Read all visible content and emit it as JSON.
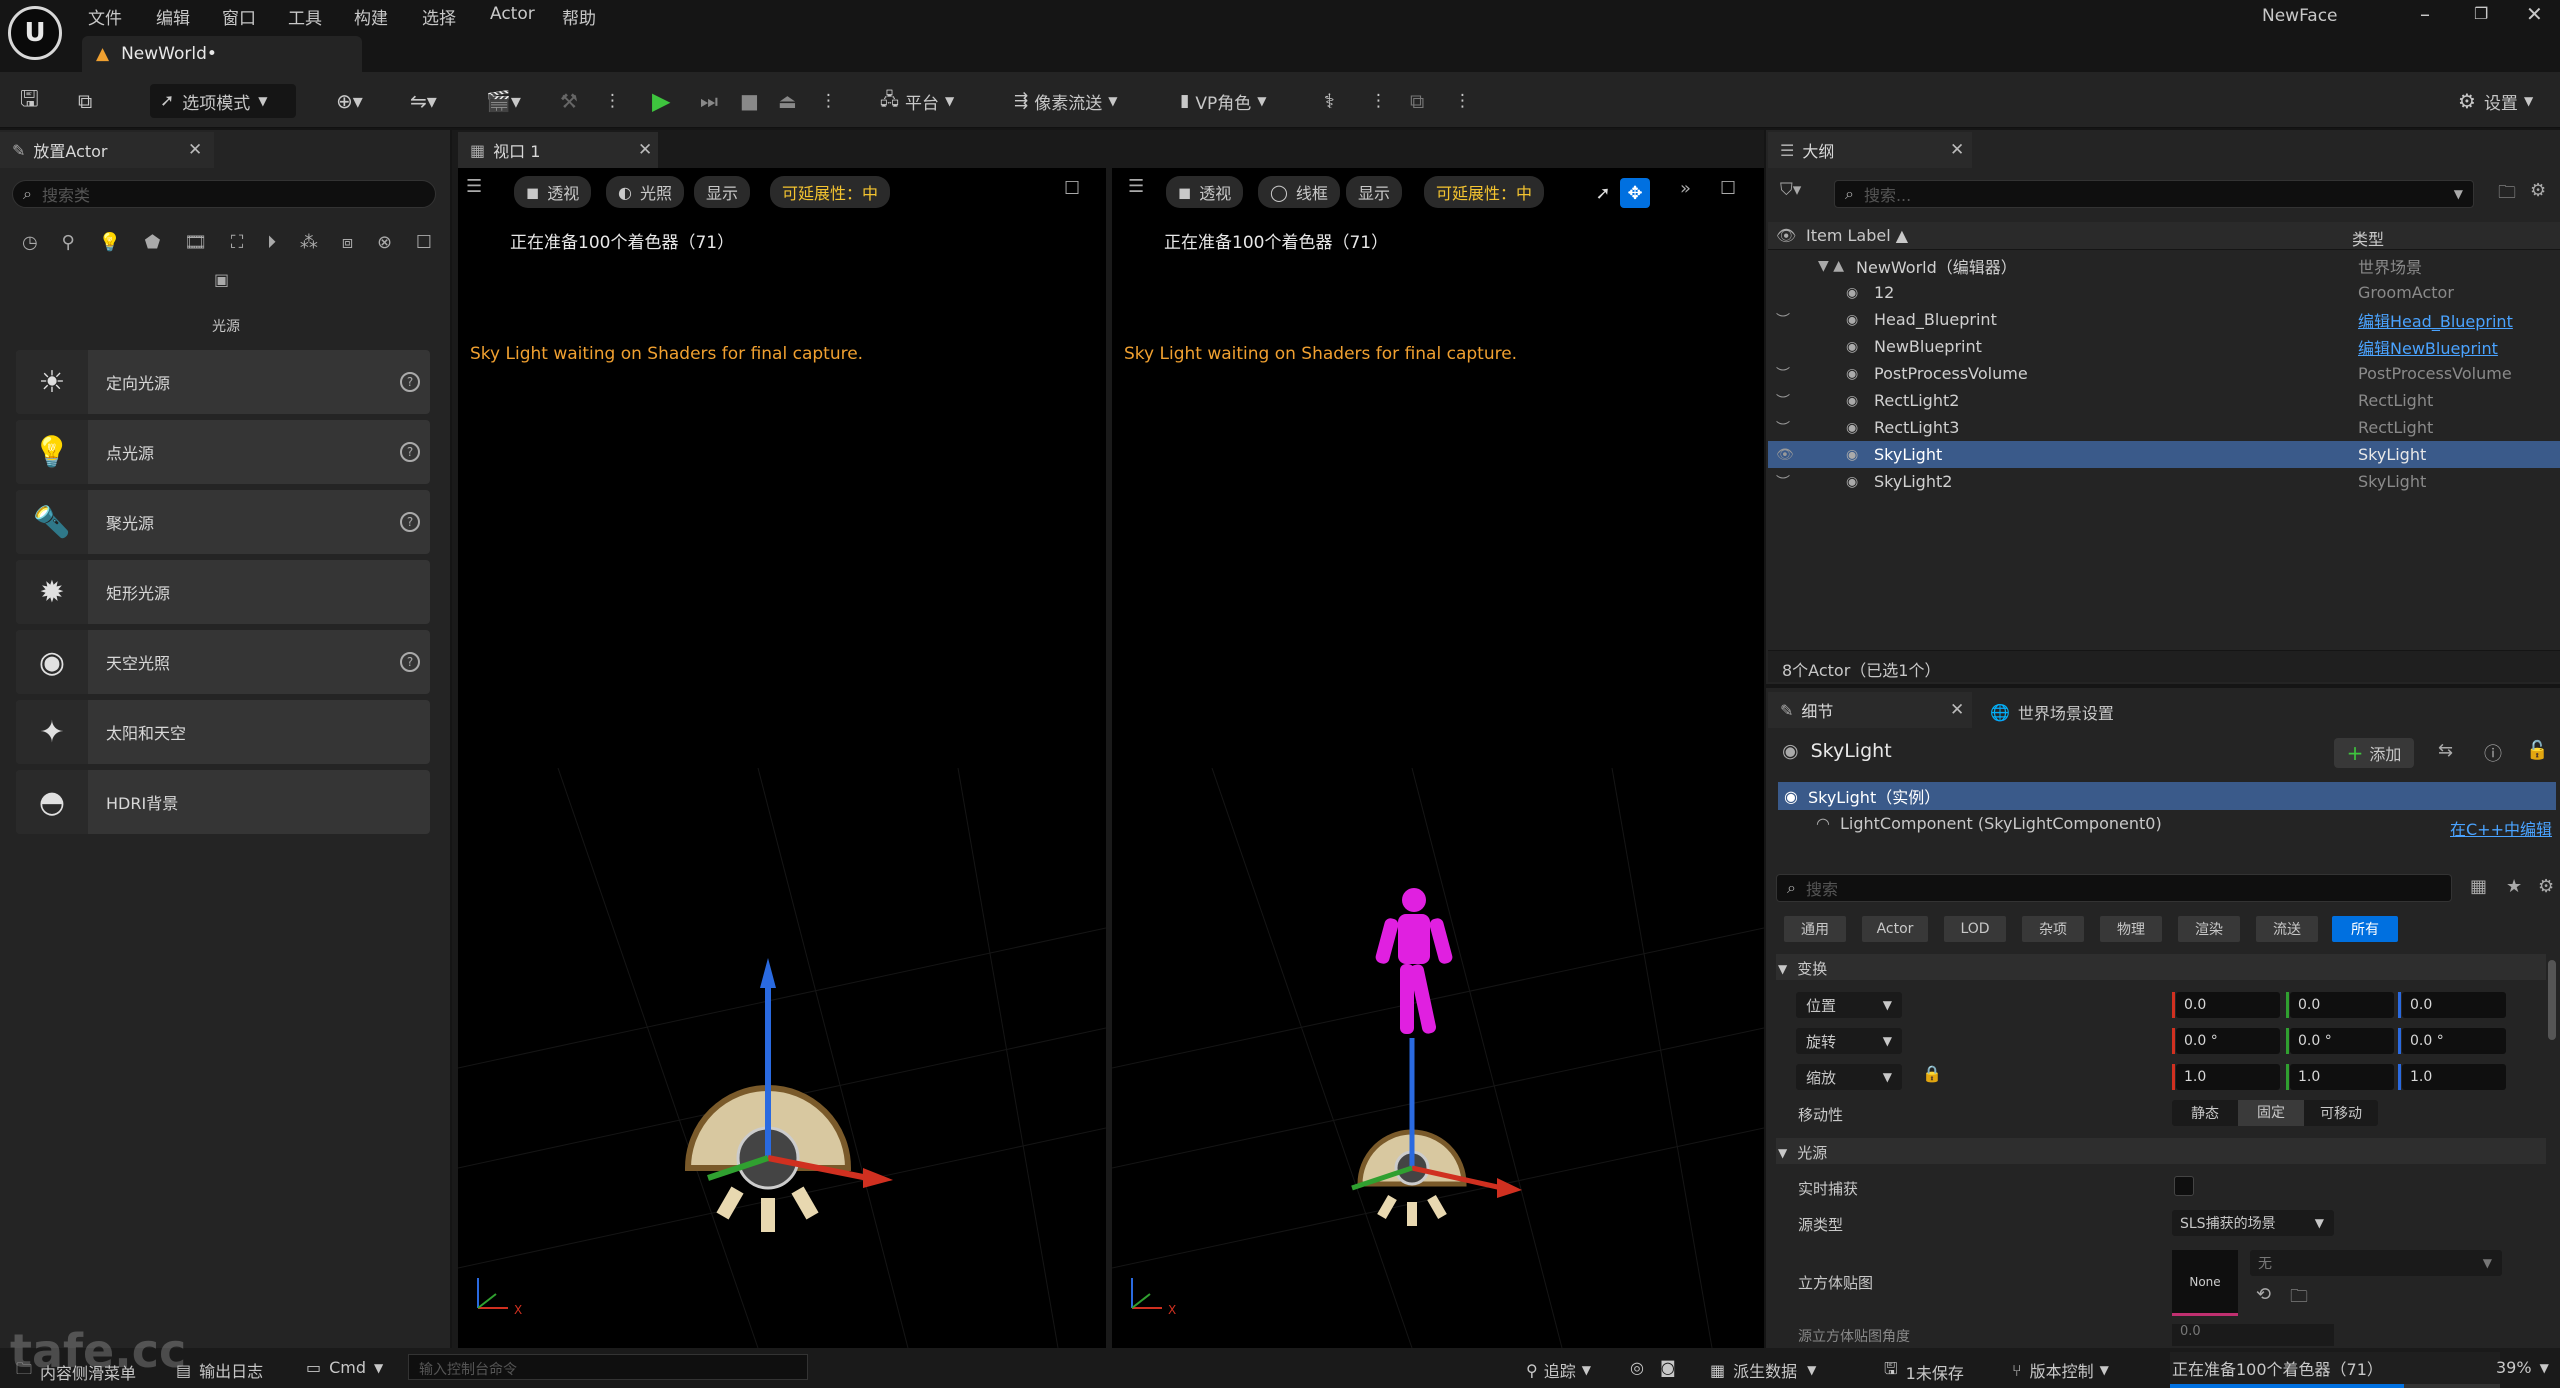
{
  "title": {
    "doc_tab": "NewWorld•",
    "project": "NewFace"
  },
  "menu": [
    "文件",
    "编辑",
    "窗口",
    "工具",
    "构建",
    "选择",
    "Actor",
    "帮助"
  ],
  "toolbar": {
    "mode": "选项模式",
    "platform": "平台",
    "pixel_stream": "像素流送",
    "vp_role": "VP角色",
    "settings": "设置"
  },
  "place_actors": {
    "tab": "放置Actor",
    "search_placeholder": "搜索类",
    "category": "光源",
    "items": [
      {
        "label": "定向光源",
        "icon": "directional-light-icon",
        "help": true
      },
      {
        "label": "点光源",
        "icon": "point-light-icon",
        "help": true
      },
      {
        "label": "聚光源",
        "icon": "spot-light-icon",
        "help": true
      },
      {
        "label": "矩形光源",
        "icon": "rect-light-icon",
        "help": false
      },
      {
        "label": "天空光照",
        "icon": "sky-light-icon",
        "help": true
      },
      {
        "label": "太阳和天空",
        "icon": "sun-sky-icon",
        "help": false
      },
      {
        "label": "HDRI背景",
        "icon": "hdri-backdrop-icon",
        "help": false
      }
    ]
  },
  "viewport": {
    "tab": "视口 1",
    "left": {
      "perspective": "透视",
      "lit": "光照",
      "show": "显示",
      "scalability": "可延展性：中",
      "status": "正在准备100个着色器（71）",
      "warning": "Sky Light waiting on Shaders for final capture."
    },
    "right": {
      "perspective": "透视",
      "wireframe": "线框",
      "show": "显示",
      "scalability": "可延展性：中",
      "status": "正在准备100个着色器（71）",
      "warning": "Sky Light waiting on Shaders for final capture."
    }
  },
  "outliner": {
    "tab": "大纲",
    "search_placeholder": "搜索...",
    "col_label": "Item Label ▲",
    "col_type": "类型",
    "rows": [
      {
        "label": "NewWorld（编辑器）",
        "type": "世界场景",
        "indent": 0,
        "link": false,
        "eye": false
      },
      {
        "label": "12",
        "type": "GroomActor",
        "indent": 1,
        "link": false,
        "eye": false
      },
      {
        "label": "Head_Blueprint",
        "type": "编辑Head_Blueprint",
        "indent": 1,
        "link": true,
        "eye": true
      },
      {
        "label": "NewBlueprint",
        "type": "编辑NewBlueprint",
        "indent": 1,
        "link": true,
        "eye": false
      },
      {
        "label": "PostProcessVolume",
        "type": "PostProcessVolume",
        "indent": 1,
        "link": false,
        "eye": true
      },
      {
        "label": "RectLight2",
        "type": "RectLight",
        "indent": 1,
        "link": false,
        "eye": true
      },
      {
        "label": "RectLight3",
        "type": "RectLight",
        "indent": 1,
        "link": false,
        "eye": true
      },
      {
        "label": "SkyLight",
        "type": "SkyLight",
        "indent": 1,
        "link": false,
        "eye": true,
        "selected": true
      },
      {
        "label": "SkyLight2",
        "type": "SkyLight",
        "indent": 1,
        "link": false,
        "eye": true
      }
    ],
    "count": "8个Actor（已选1个）"
  },
  "details": {
    "tab": "细节",
    "tab2": "世界场景设置",
    "actor_name": "SkyLight",
    "add": "添加",
    "instance": "SkyLight（实例）",
    "component": "LightComponent (SkyLightComponent0)",
    "edit_cpp": "在C++中编辑",
    "search_placeholder": "搜索",
    "filters": [
      "通用",
      "Actor",
      "LOD",
      "杂项",
      "物理",
      "渲染",
      "流送",
      "所有"
    ],
    "transform_section": "变换",
    "location": {
      "label": "位置",
      "x": "0.0",
      "y": "0.0",
      "z": "0.0"
    },
    "rotation": {
      "label": "旋转",
      "x": "0.0 °",
      "y": "0.0 °",
      "z": "0.0 °"
    },
    "scale": {
      "label": "缩放",
      "x": "1.0",
      "y": "1.0",
      "z": "1.0"
    },
    "mobility": {
      "label": "移动性",
      "options": [
        "静态",
        "固定",
        "可移动"
      ],
      "selected": "固定"
    },
    "light_section": "光源",
    "realtime_capture": "实时捕获",
    "source_type": {
      "label": "源类型",
      "value": "SLS捕获的场景"
    },
    "cubemap": {
      "label": "立方体贴图",
      "thumb": "None",
      "value": "无"
    },
    "cubemap_angle": {
      "label": "源立方体贴图角度",
      "value": "0.0"
    }
  },
  "statusbar": {
    "content": "内容侧滑菜单",
    "output": "输出日志",
    "cmd": "Cmd",
    "cmd_placeholder": "输入控制台命令",
    "trace": "追踪",
    "derived": "派生数据",
    "unsaved": "1未保存",
    "source_control": "版本控制",
    "progress_text": "正在准备100个着色器（71）",
    "zoom": "39%",
    "watermark": "tafe.cc"
  },
  "colors": {
    "accent_blue": "#0070e0",
    "selection": "#3a5a8a",
    "warning_orange": "#f0a030",
    "scalability_yellow": "#f4c430"
  }
}
